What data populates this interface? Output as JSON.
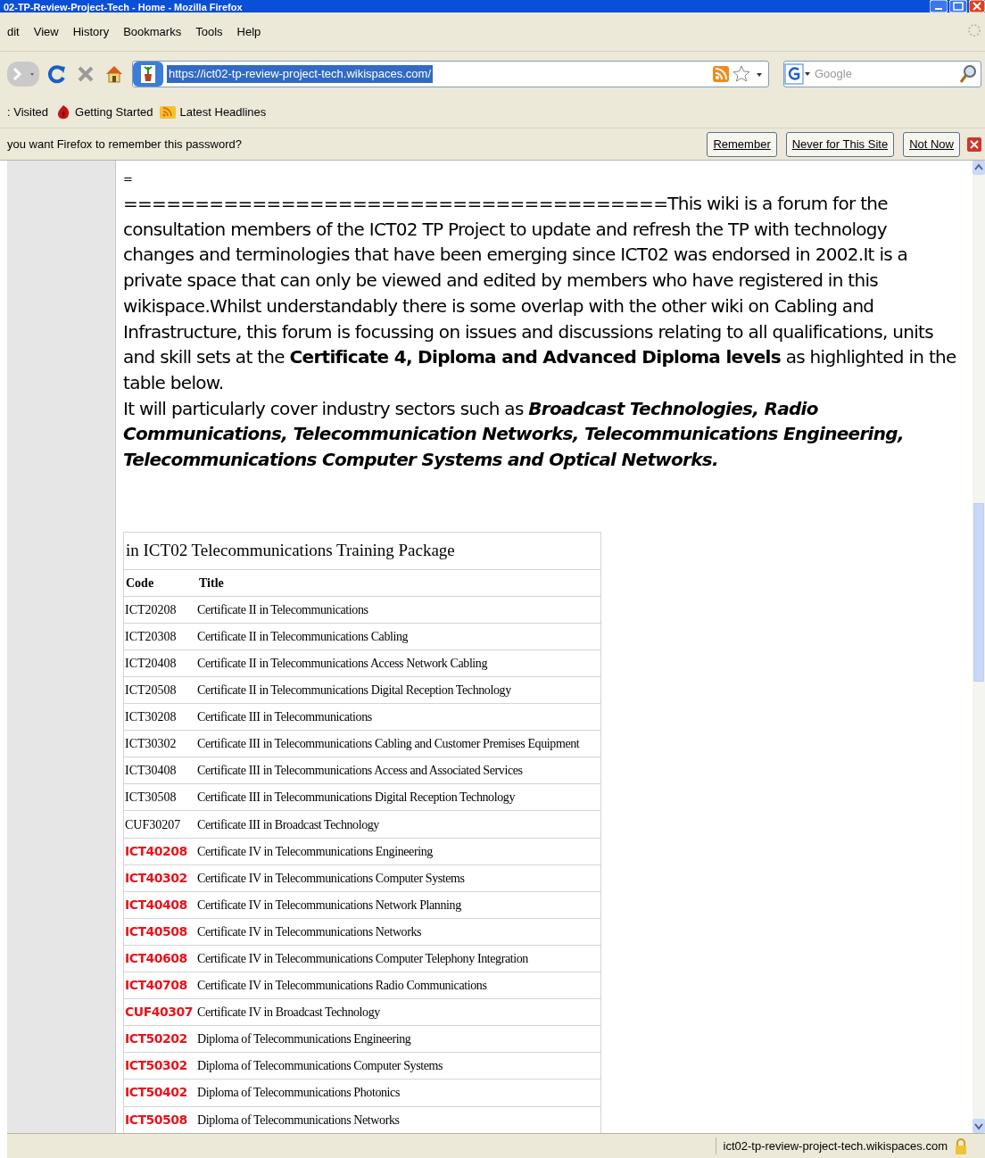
{
  "window": {
    "title": "02-TP-Review-Project-Tech - Home - Mozilla Firefox"
  },
  "menu": [
    {
      "label": "dit"
    },
    {
      "label": "View"
    },
    {
      "label": "History"
    },
    {
      "label": "Bookmarks"
    },
    {
      "label": "Tools"
    },
    {
      "label": "Help"
    }
  ],
  "address_bar": {
    "value": "https://ict02-tp-review-project-tech.wikispaces.com/"
  },
  "search": {
    "placeholder": "Google"
  },
  "bookmarks": [
    {
      "label": ": Visited",
      "kind": "text"
    },
    {
      "label": "Getting Started",
      "kind": "start"
    },
    {
      "label": "Latest Headlines",
      "kind": "feed"
    }
  ],
  "notification": {
    "text": "you want Firefox to remember this password?",
    "buttons": [
      "Remember",
      "Never for This Site",
      "Not Now"
    ]
  },
  "content": {
    "paragraphs": [
      "=",
      "======================================This wiki is a forum for the consultation members of the ICT02 TP Project to update and refresh the TP with technology changes and terminologies that have been emerging since ICT02 was endorsed in 2002.It is a private space that can only be viewed and edited by members who have registered in this wikispace.Whilst understandably there is some overlap with the other wiki on Cabling and Infrastructure, this forum is focussing on issues and discussions relating to all qualifications, units and skill sets at the **Certificate 4, Diploma and Advanced Diploma levels** as highlighted in the table below.",
      "It will particularly cover industry sectors such as *Broadcast Technologies, Radio Communications, Telecommunication Networks, Telecommunications Engineering, Telecommunications Computer Systems and Optical Networks.*"
    ],
    "table": {
      "caption": "in ICT02 Telecommunications Training Package",
      "columns": [
        "Code",
        "Title"
      ],
      "rows": [
        {
          "code": "ICT20208",
          "title": "Certificate II in Telecommunications",
          "highlighted": false
        },
        {
          "code": "ICT20308",
          "title": "Certificate II in Telecommunications Cabling",
          "highlighted": false
        },
        {
          "code": "ICT20408",
          "title": "Certificate II in Telecommunications Access Network Cabling",
          "highlighted": false
        },
        {
          "code": "ICT20508",
          "title": "Certificate II in Telecommunications Digital Reception Technology",
          "highlighted": false
        },
        {
          "code": "ICT30208",
          "title": "Certificate III in Telecommunications",
          "highlighted": false
        },
        {
          "code": "ICT30302",
          "title": "Certificate III in Telecommunications Cabling and Customer Premises Equipment",
          "highlighted": false
        },
        {
          "code": "ICT30408",
          "title": "Certificate III in Telecommunications Access and Associated Services",
          "highlighted": false
        },
        {
          "code": "ICT30508",
          "title": "Certificate III in Telecommunications Digital Reception Technology",
          "highlighted": false
        },
        {
          "code": "CUF30207",
          "title": "Certificate III in Broadcast Technology",
          "highlighted": false
        },
        {
          "code": "ICT40208",
          "title": "Certificate IV in Telecommunications Engineering",
          "highlighted": true
        },
        {
          "code": "ICT40302",
          "title": "Certificate IV in Telecommunications Computer Systems",
          "highlighted": true
        },
        {
          "code": "ICT40408",
          "title": "Certificate IV in Telecommunications Network Planning",
          "highlighted": true
        },
        {
          "code": "ICT40508",
          "title": "Certificate IV in Telecommunications Networks",
          "highlighted": true
        },
        {
          "code": "ICT40608",
          "title": "Certificate IV in Telecommunications Computer Telephony Integration",
          "highlighted": true
        },
        {
          "code": "ICT40708",
          "title": "Certificate IV in Telecommunications Radio Communications",
          "highlighted": true
        },
        {
          "code": "CUF40307",
          "title": "Certificate IV in Broadcast Technology",
          "highlighted": true
        },
        {
          "code": "ICT50202",
          "title": "Diploma of Telecommunications Engineering",
          "highlighted": true
        },
        {
          "code": "ICT50302",
          "title": "Diploma of Telecommunications Computer Systems",
          "highlighted": true
        },
        {
          "code": "ICT50402",
          "title": "Diploma of Telecommunications Photonics",
          "highlighted": true
        },
        {
          "code": "ICT50508",
          "title": "Diploma of Telecommunications Networks",
          "highlighted": true
        }
      ]
    }
  },
  "status_bar": {
    "text": "ict02-tp-review-project-tech.wikispaces.com"
  }
}
